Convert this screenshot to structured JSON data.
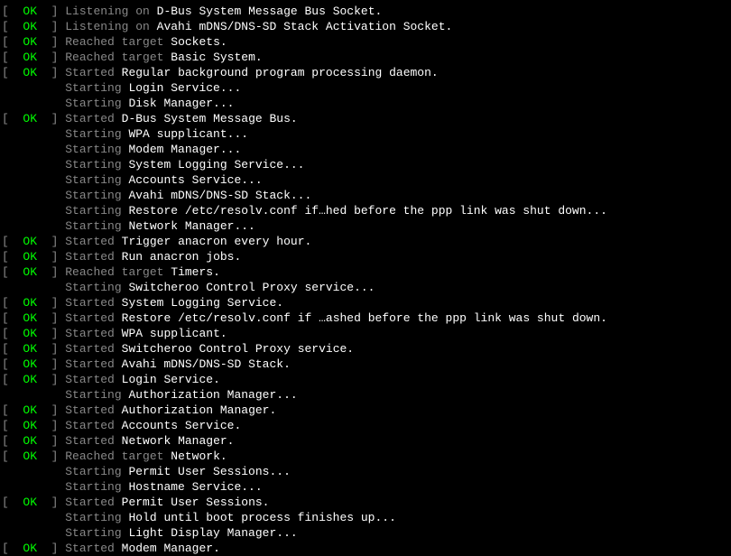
{
  "colors": {
    "ok": "#00ff00",
    "dim": "#888888",
    "bright": "#ffffff"
  },
  "status_label": "OK",
  "lines": [
    {
      "status": "OK",
      "action": "Listening on",
      "subject": "D-Bus System Message Bus Socket."
    },
    {
      "status": "OK",
      "action": "Listening on",
      "subject": "Avahi mDNS/DNS-SD Stack Activation Socket."
    },
    {
      "status": "OK",
      "action": "Reached target",
      "subject": "Sockets."
    },
    {
      "status": "OK",
      "action": "Reached target",
      "subject": "Basic System."
    },
    {
      "status": "OK",
      "action": "Started",
      "subject": "Regular background program processing daemon."
    },
    {
      "status": null,
      "action": "Starting",
      "subject": "Login Service..."
    },
    {
      "status": null,
      "action": "Starting",
      "subject": "Disk Manager..."
    },
    {
      "status": "OK",
      "action": "Started",
      "subject": "D-Bus System Message Bus."
    },
    {
      "status": null,
      "action": "Starting",
      "subject": "WPA supplicant..."
    },
    {
      "status": null,
      "action": "Starting",
      "subject": "Modem Manager..."
    },
    {
      "status": null,
      "action": "Starting",
      "subject": "System Logging Service..."
    },
    {
      "status": null,
      "action": "Starting",
      "subject": "Accounts Service..."
    },
    {
      "status": null,
      "action": "Starting",
      "subject": "Avahi mDNS/DNS-SD Stack..."
    },
    {
      "status": null,
      "action": "Starting",
      "subject": "Restore /etc/resolv.conf if…hed before the ppp link was shut down..."
    },
    {
      "status": null,
      "action": "Starting",
      "subject": "Network Manager..."
    },
    {
      "status": "OK",
      "action": "Started",
      "subject": "Trigger anacron every hour."
    },
    {
      "status": "OK",
      "action": "Started",
      "subject": "Run anacron jobs."
    },
    {
      "status": "OK",
      "action": "Reached target",
      "subject": "Timers."
    },
    {
      "status": null,
      "action": "Starting",
      "subject": "Switcheroo Control Proxy service..."
    },
    {
      "status": "OK",
      "action": "Started",
      "subject": "System Logging Service."
    },
    {
      "status": "OK",
      "action": "Started",
      "subject": "Restore /etc/resolv.conf if …ashed before the ppp link was shut down."
    },
    {
      "status": "OK",
      "action": "Started",
      "subject": "WPA supplicant."
    },
    {
      "status": "OK",
      "action": "Started",
      "subject": "Switcheroo Control Proxy service."
    },
    {
      "status": "OK",
      "action": "Started",
      "subject": "Avahi mDNS/DNS-SD Stack."
    },
    {
      "status": "OK",
      "action": "Started",
      "subject": "Login Service."
    },
    {
      "status": null,
      "action": "Starting",
      "subject": "Authorization Manager..."
    },
    {
      "status": "OK",
      "action": "Started",
      "subject": "Authorization Manager."
    },
    {
      "status": "OK",
      "action": "Started",
      "subject": "Accounts Service."
    },
    {
      "status": "OK",
      "action": "Started",
      "subject": "Network Manager."
    },
    {
      "status": "OK",
      "action": "Reached target",
      "subject": "Network."
    },
    {
      "status": null,
      "action": "Starting",
      "subject": "Permit User Sessions..."
    },
    {
      "status": null,
      "action": "Starting",
      "subject": "Hostname Service..."
    },
    {
      "status": "OK",
      "action": "Started",
      "subject": "Permit User Sessions."
    },
    {
      "status": null,
      "action": "Starting",
      "subject": "Hold until boot process finishes up..."
    },
    {
      "status": null,
      "action": "Starting",
      "subject": "Light Display Manager..."
    },
    {
      "status": "OK",
      "action": "Started",
      "subject": "Modem Manager."
    }
  ]
}
